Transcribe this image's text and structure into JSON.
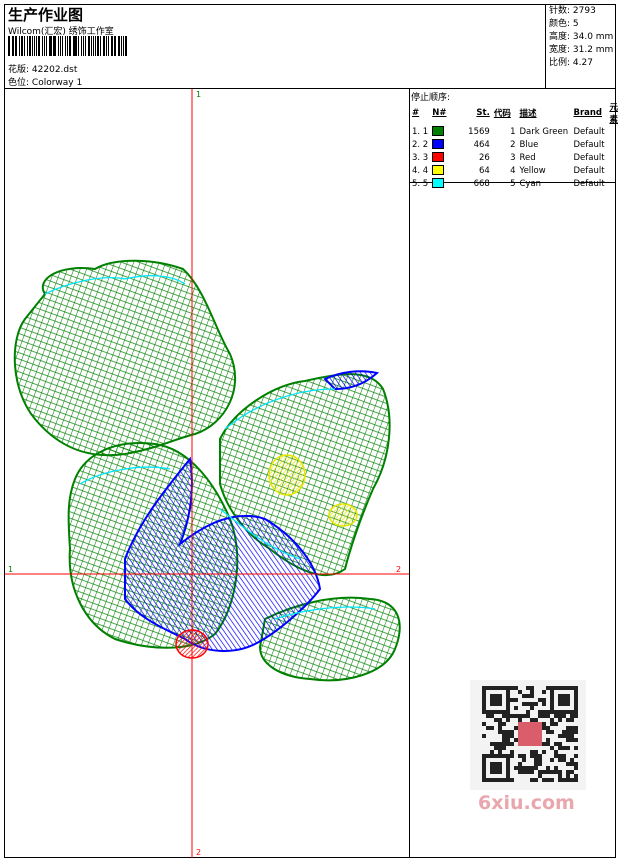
{
  "header": {
    "title": "生产作业图",
    "subtitle": "Wilcom(汇宏) 绣饰工作室",
    "design_label": "花版:",
    "design_value": "42202.dst",
    "colorway_label": "色位:",
    "colorway_value": "Colorway 1"
  },
  "stats": {
    "stitches": "针数: 2793",
    "colors": "颜色: 5",
    "height": "高度: 34.0 mm",
    "width": "宽度: 31.2 mm",
    "scale": "比例: 4.27"
  },
  "stop_sequence": {
    "title": "停止顺序:",
    "columns": [
      "#",
      "N#",
      "St.",
      "代码",
      "描述",
      "Brand",
      "元素"
    ],
    "rows": [
      {
        "idx": "1. 1",
        "color": "#008000",
        "st": "1569",
        "code": "1",
        "desc": "Dark Green",
        "brand": "Default"
      },
      {
        "idx": "2. 2",
        "color": "#0000ff",
        "st": "464",
        "code": "2",
        "desc": "Blue",
        "brand": "Default"
      },
      {
        "idx": "3. 3",
        "color": "#ff0000",
        "st": "26",
        "code": "3",
        "desc": "Red",
        "brand": "Default"
      },
      {
        "idx": "4. 4",
        "color": "#ffff00",
        "st": "64",
        "code": "4",
        "desc": "Yellow",
        "brand": "Default"
      },
      {
        "idx": "5. 5",
        "color": "#00ffff",
        "st": "668",
        "code": "5",
        "desc": "Cyan",
        "brand": "Default"
      }
    ]
  },
  "axes": {
    "top": "1",
    "left": "1",
    "right": "2",
    "bottom": "2"
  },
  "watermark": "6xiu.com",
  "colors": {
    "dark_green": "#008000",
    "blue": "#0000ff",
    "red": "#ff0000",
    "yellow": "#ffff00",
    "cyan": "#00ffff",
    "axis": "#ff0000"
  }
}
